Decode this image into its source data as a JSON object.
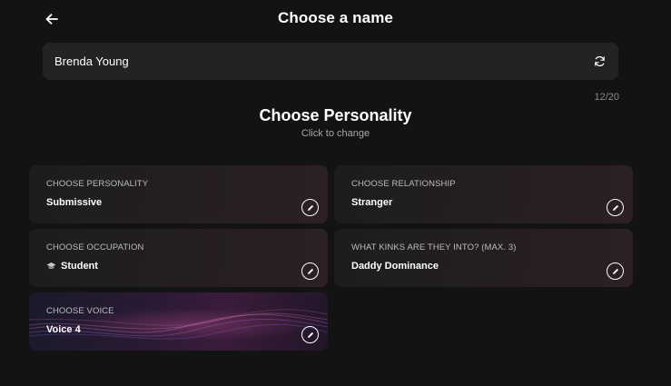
{
  "header": {
    "title": "Choose a name"
  },
  "name_field": {
    "value": "Brenda Young",
    "char_count": "12/20"
  },
  "section": {
    "title": "Choose Personality",
    "subtitle": "Click to change"
  },
  "cards": {
    "personality": {
      "label": "CHOOSE PERSONALITY",
      "value": "Submissive"
    },
    "relationship": {
      "label": "CHOOSE RELATIONSHIP",
      "value": "Stranger"
    },
    "occupation": {
      "label": "CHOOSE OCCUPATION",
      "value": "Student",
      "icon": "graduation-cap-icon"
    },
    "kinks": {
      "label": "WHAT KINKS ARE THEY INTO? (MAX. 3)",
      "value": "Daddy Dominance"
    },
    "voice": {
      "label": "CHOOSE VOICE",
      "value": "Voice 4"
    }
  },
  "colors": {
    "background": "#131313",
    "field": "#232323",
    "card": "#1f1c1e"
  }
}
